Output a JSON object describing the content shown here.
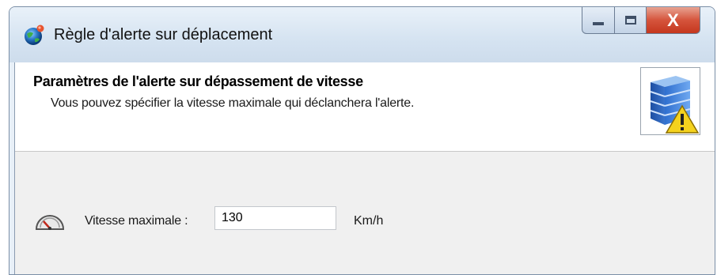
{
  "window": {
    "title": "Règle d'alerte sur déplacement",
    "title_icon": "globe-icon",
    "controls": {
      "minimize_icon": "minimize-icon",
      "maximize_icon": "maximize-icon",
      "close_label": "X"
    }
  },
  "header": {
    "title": "Paramètres de l'alerte sur dépassement de vitesse",
    "subtitle": "Vous pouvez spécifier la vitesse maximale qui déclanchera l'alerte.",
    "image_icon": "server-warning-icon"
  },
  "form": {
    "speed_icon": "speedometer-icon",
    "speed_label": "Vitesse maximale :",
    "speed_value": "130",
    "speed_unit": "Km/h"
  },
  "colors": {
    "close_button": "#c5371e",
    "titlebar": "#d5e3f1",
    "warning": "#f4d21e"
  }
}
